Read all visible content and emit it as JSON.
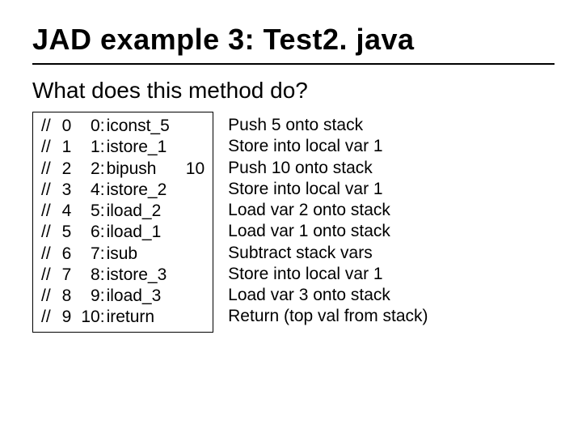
{
  "title": "JAD example 3: Test2. java",
  "subtitle": "What does this method do?",
  "code": {
    "rows": [
      {
        "c": "//",
        "i": "0",
        "n": "0:",
        "ins": "iconst_5",
        "arg": ""
      },
      {
        "c": "//",
        "i": "1",
        "n": "1:",
        "ins": "istore_1",
        "arg": ""
      },
      {
        "c": "//",
        "i": "2",
        "n": "2:",
        "ins": "bipush",
        "arg": "10"
      },
      {
        "c": "//",
        "i": "3",
        "n": "4:",
        "ins": "istore_2",
        "arg": ""
      },
      {
        "c": "//",
        "i": "4",
        "n": "5:",
        "ins": "iload_2",
        "arg": ""
      },
      {
        "c": "//",
        "i": "5",
        "n": "6:",
        "ins": "iload_1",
        "arg": ""
      },
      {
        "c": "//",
        "i": "6",
        "n": "7:",
        "ins": "isub",
        "arg": ""
      },
      {
        "c": "//",
        "i": "7",
        "n": "8:",
        "ins": "istore_3",
        "arg": ""
      },
      {
        "c": "//",
        "i": "8",
        "n": "9:",
        "ins": "iload_3",
        "arg": ""
      },
      {
        "c": "//",
        "i": "9",
        "n": "10:",
        "ins": "ireturn",
        "arg": ""
      }
    ]
  },
  "desc": [
    "Push 5 onto stack",
    "Store into local var 1",
    "Push 10 onto stack",
    "Store into local var 1",
    "Load var 2 onto stack",
    "Load var 1 onto stack",
    "Subtract stack vars",
    "Store into local var 1",
    "Load var 3 onto stack",
    "Return (top val from stack)"
  ]
}
